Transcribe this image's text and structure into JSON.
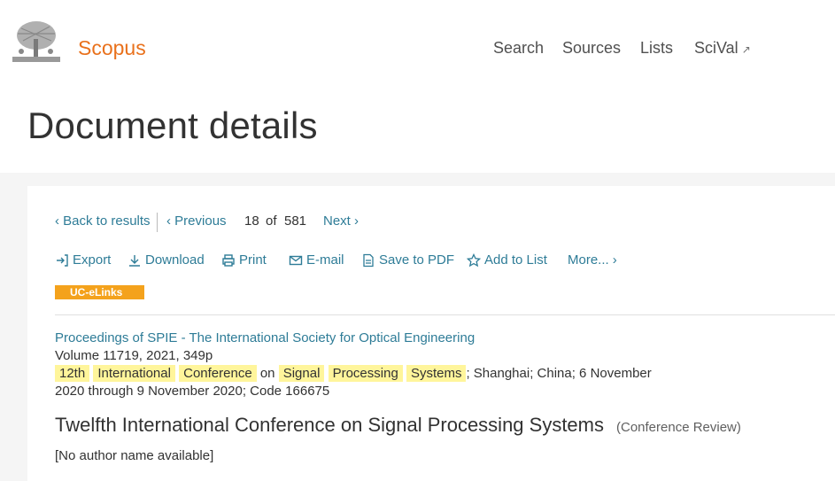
{
  "header": {
    "brand": "Scopus",
    "nav": [
      "Search",
      "Sources",
      "Lists",
      "SciVal"
    ],
    "scival_ext_icon": "external-arrow-icon"
  },
  "page_title": "Document details",
  "pager": {
    "back": "Back to results",
    "previous": "Previous",
    "current": "18",
    "of": "of",
    "total": "581",
    "next": "Next"
  },
  "toolbar": {
    "export": "Export",
    "download": "Download",
    "print": "Print",
    "email": "E-mail",
    "save_pdf": "Save to PDF",
    "add_list": "Add to List",
    "more": "More..."
  },
  "uc_elinks": "UC-eLinks",
  "document": {
    "source": "Proceedings of SPIE - The International Society for Optical Engineering",
    "volume": "Volume 11719, 2021, 349p",
    "conf_words": [
      "12th",
      "International",
      "Conference",
      "on",
      "Signal",
      "Processing",
      "Systems"
    ],
    "conf_rest": "; Shanghai; China; 6 November",
    "conf_line2": "2020 through 9 November 2020; Code 166675",
    "title": "Twelfth International Conference on Signal Processing Systems",
    "type": "(Conference Review)",
    "author": "[No author name available]"
  },
  "colors": {
    "accent": "#e9711c",
    "link": "#2e7c97",
    "highlight": "#fff59b",
    "badge": "#f4a21c"
  }
}
